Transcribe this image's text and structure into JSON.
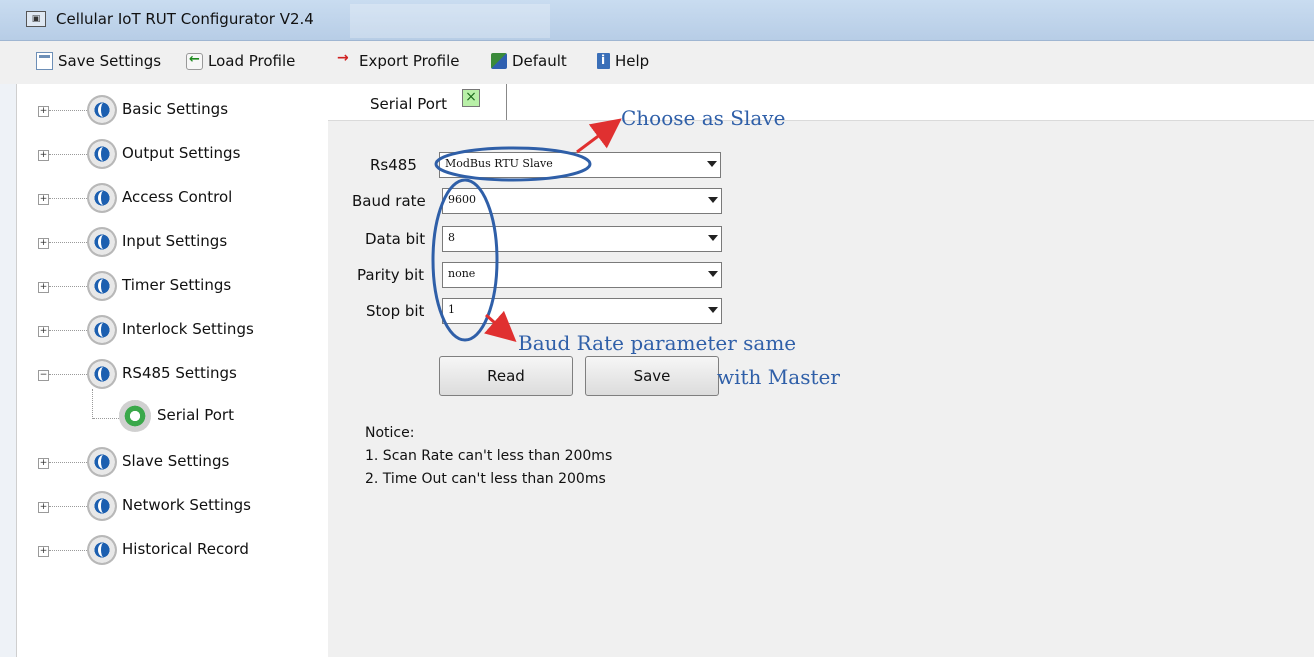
{
  "window": {
    "title": "Cellular IoT RUT Configurator V2.4"
  },
  "toolbar": {
    "save_settings": "Save Settings",
    "load_profile": "Load Profile",
    "export_profile": "Export Profile",
    "default": "Default",
    "help": "Help"
  },
  "tree": {
    "items": [
      {
        "label": "Basic Settings"
      },
      {
        "label": "Output Settings"
      },
      {
        "label": "Access Control"
      },
      {
        "label": "Input Settings"
      },
      {
        "label": "Timer Settings"
      },
      {
        "label": "Interlock Settings"
      },
      {
        "label": "RS485 Settings"
      },
      {
        "label": "Slave Settings"
      },
      {
        "label": "Network Settings"
      },
      {
        "label": "Historical Record"
      }
    ],
    "child_serial_port": "Serial Port"
  },
  "tab": {
    "label": "Serial Port",
    "close_glyph": "×"
  },
  "form": {
    "rs485": {
      "label": "Rs485",
      "value": "ModBus RTU Slave"
    },
    "baud_rate": {
      "label": "Baud rate",
      "value": "9600"
    },
    "data_bit": {
      "label": "Data bit",
      "value": "8"
    },
    "parity_bit": {
      "label": "Parity bit",
      "value": "none"
    },
    "stop_bit": {
      "label": "Stop bit",
      "value": "1"
    }
  },
  "buttons": {
    "read": "Read",
    "save": "Save"
  },
  "notice": {
    "title": "Notice:",
    "line1": "1. Scan Rate can't less than 200ms",
    "line2": "2. Time Out  can't less than 200ms"
  },
  "annotations": {
    "choose_slave": "Choose as Slave",
    "baud_line1": "Baud Rate parameter same",
    "baud_line2": "with Master"
  },
  "colors": {
    "annotation_outline": "#2f5fa8",
    "annotation_arrow": "#e03030",
    "annotation_text": "#2f5fa8"
  }
}
